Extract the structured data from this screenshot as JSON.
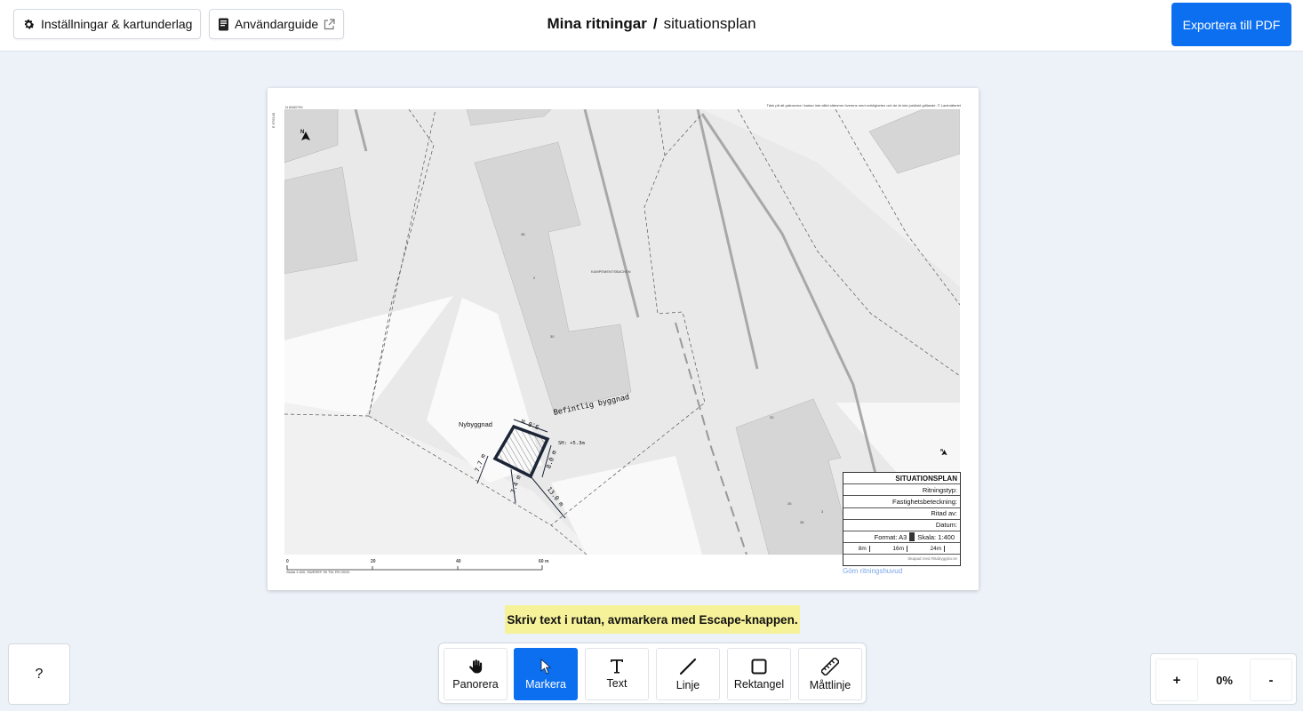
{
  "header": {
    "settings_label": "Inställningar & kartunderlag",
    "guide_label": "Användarguide",
    "title_main": "Mina ritningar",
    "title_separator": "/",
    "title_sub": "situationsplan",
    "export_label": "Exportera till PDF"
  },
  "sheet": {
    "top_left_code": "N 6580790",
    "top_right_notice": "Tänk på att gränserna i kartan inte alltid stämmer överens med verkligheten och de är inte juridiskt gällande. © Lantmäteriet",
    "side_code_left": "E 676140",
    "side_code_right": "E 676200",
    "map_labels": {
      "street": "KAMPEMENTSBACKEN",
      "num_1": "38",
      "num_2": "2",
      "num_3": "30",
      "num_4": "32",
      "num_5": "26",
      "num_6": "3",
      "num_7": "36"
    },
    "drawing": {
      "existing_building": "Befintlig byggnad",
      "new_building": "Nybyggnad",
      "roof_height": "SH: +5.3m",
      "dim_top": "9.0 m",
      "dim_right": "8.0 m",
      "dim_left": "7.7 m",
      "dim_bottom": "7.4 m",
      "dim_diag": "13.0 m"
    },
    "north_letter": "N",
    "scale_bar": {
      "ticks": [
        "0",
        "20",
        "40",
        "60 m"
      ],
      "caption": "Skala 1:400, SWEREF 99 TM, RH 2000."
    },
    "title_block": {
      "heading": "SITUATIONSPLAN",
      "rows": [
        "Ritningstyp:",
        "Fastighetsbeteckning:",
        "Ritad av:",
        "Datum:"
      ],
      "format": "Format: A3",
      "scale": "Skala: 1:400",
      "scale_marks": [
        "8m",
        "16m",
        "24m"
      ],
      "credit": "Skapad med Ritabygglov.se"
    },
    "hide_header_label": "Göm ritningshuvud"
  },
  "hint": "Skriv text i rutan, avmarkera med Escape-knappen.",
  "tools": [
    {
      "label": "Panorera",
      "icon": "hand-icon"
    },
    {
      "label": "Markera",
      "icon": "cursor-icon",
      "active": true
    },
    {
      "label": "Text",
      "icon": "text-icon"
    },
    {
      "label": "Linje",
      "icon": "line-icon"
    },
    {
      "label": "Rektangel",
      "icon": "square-icon"
    },
    {
      "label": "Måttlinje",
      "icon": "ruler-icon"
    }
  ],
  "help_label": "?",
  "zoom": {
    "plus": "+",
    "value": "0%",
    "minus": "-"
  },
  "colors": {
    "accent": "#0b6ff0",
    "hint_bg": "#f6f29a",
    "background": "#edf1f8"
  }
}
